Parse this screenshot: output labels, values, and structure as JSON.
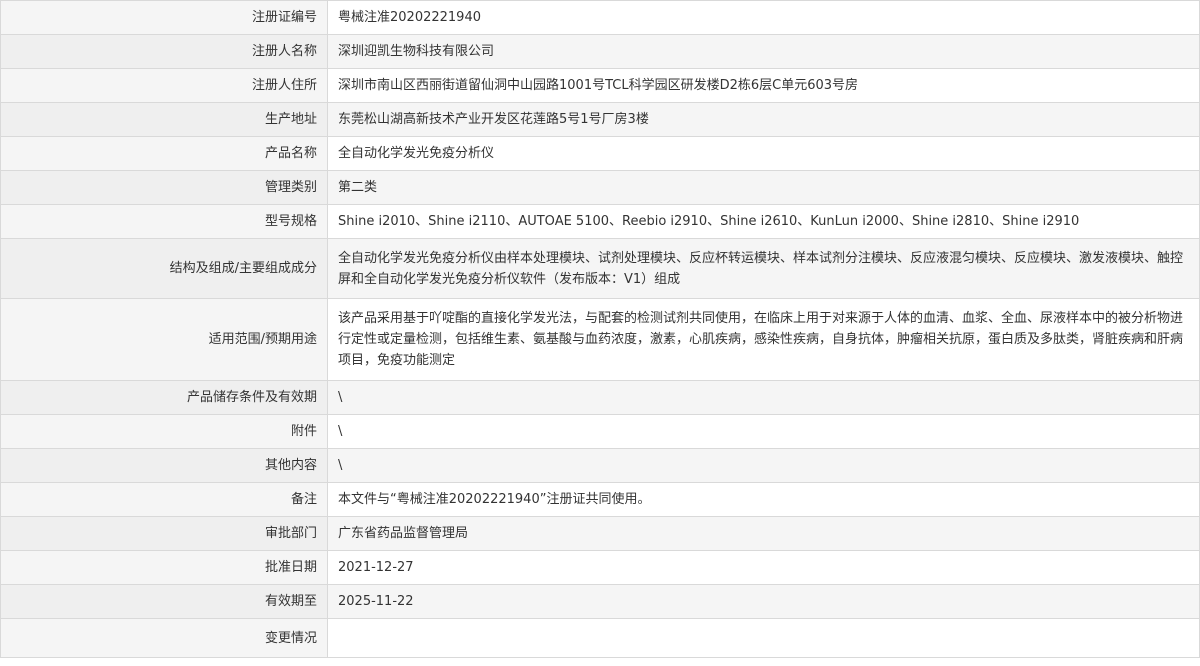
{
  "rows": [
    {
      "label": "注册证编号",
      "value": "粤械注准20202221940"
    },
    {
      "label": "注册人名称",
      "value": "深圳迎凯生物科技有限公司"
    },
    {
      "label": "注册人住所",
      "value": "深圳市南山区西丽街道留仙洞中山园路1001号TCL科学园区研发楼D2栋6层C单元603号房"
    },
    {
      "label": "生产地址",
      "value": "东莞松山湖高新技术产业开发区花莲路5号1号厂房3楼"
    },
    {
      "label": "产品名称",
      "value": "全自动化学发光免疫分析仪"
    },
    {
      "label": "管理类别",
      "value": "第二类"
    },
    {
      "label": "型号规格",
      "value": "Shine i2010、Shine i2110、AUTOAE 5100、Reebio i2910、Shine i2610、KunLun i2000、Shine i2810、Shine i2910"
    },
    {
      "label": "结构及组成/主要组成成分",
      "value": "全自动化学发光免疫分析仪由样本处理模块、试剂处理模块、反应杯转运模块、样本试剂分注模块、反应液混匀模块、反应模块、激发液模块、触控屏和全自动化学发光免疫分析仪软件（发布版本：V1）组成"
    },
    {
      "label": "适用范围/预期用途",
      "value": "该产品采用基于吖啶酯的直接化学发光法，与配套的检测试剂共同使用，在临床上用于对来源于人体的血清、血浆、全血、尿液样本中的被分析物进行定性或定量检测，包括维生素、氨基酸与血药浓度，激素，心肌疾病，感染性疾病，自身抗体，肿瘤相关抗原，蛋白质及多肽类，肾脏疾病和肝病项目，免疫功能测定"
    },
    {
      "label": "产品储存条件及有效期",
      "value": "\\"
    },
    {
      "label": "附件",
      "value": "\\"
    },
    {
      "label": "其他内容",
      "value": "\\"
    },
    {
      "label": "备注",
      "value": "本文件与“粤械注准20202221940”注册证共同使用。"
    },
    {
      "label": "审批部门",
      "value": "广东省药品监督管理局"
    },
    {
      "label": "批准日期",
      "value": "2021-12-27"
    },
    {
      "label": "有效期至",
      "value": "2025-11-22"
    },
    {
      "label": "变更情况",
      "value": ""
    }
  ]
}
